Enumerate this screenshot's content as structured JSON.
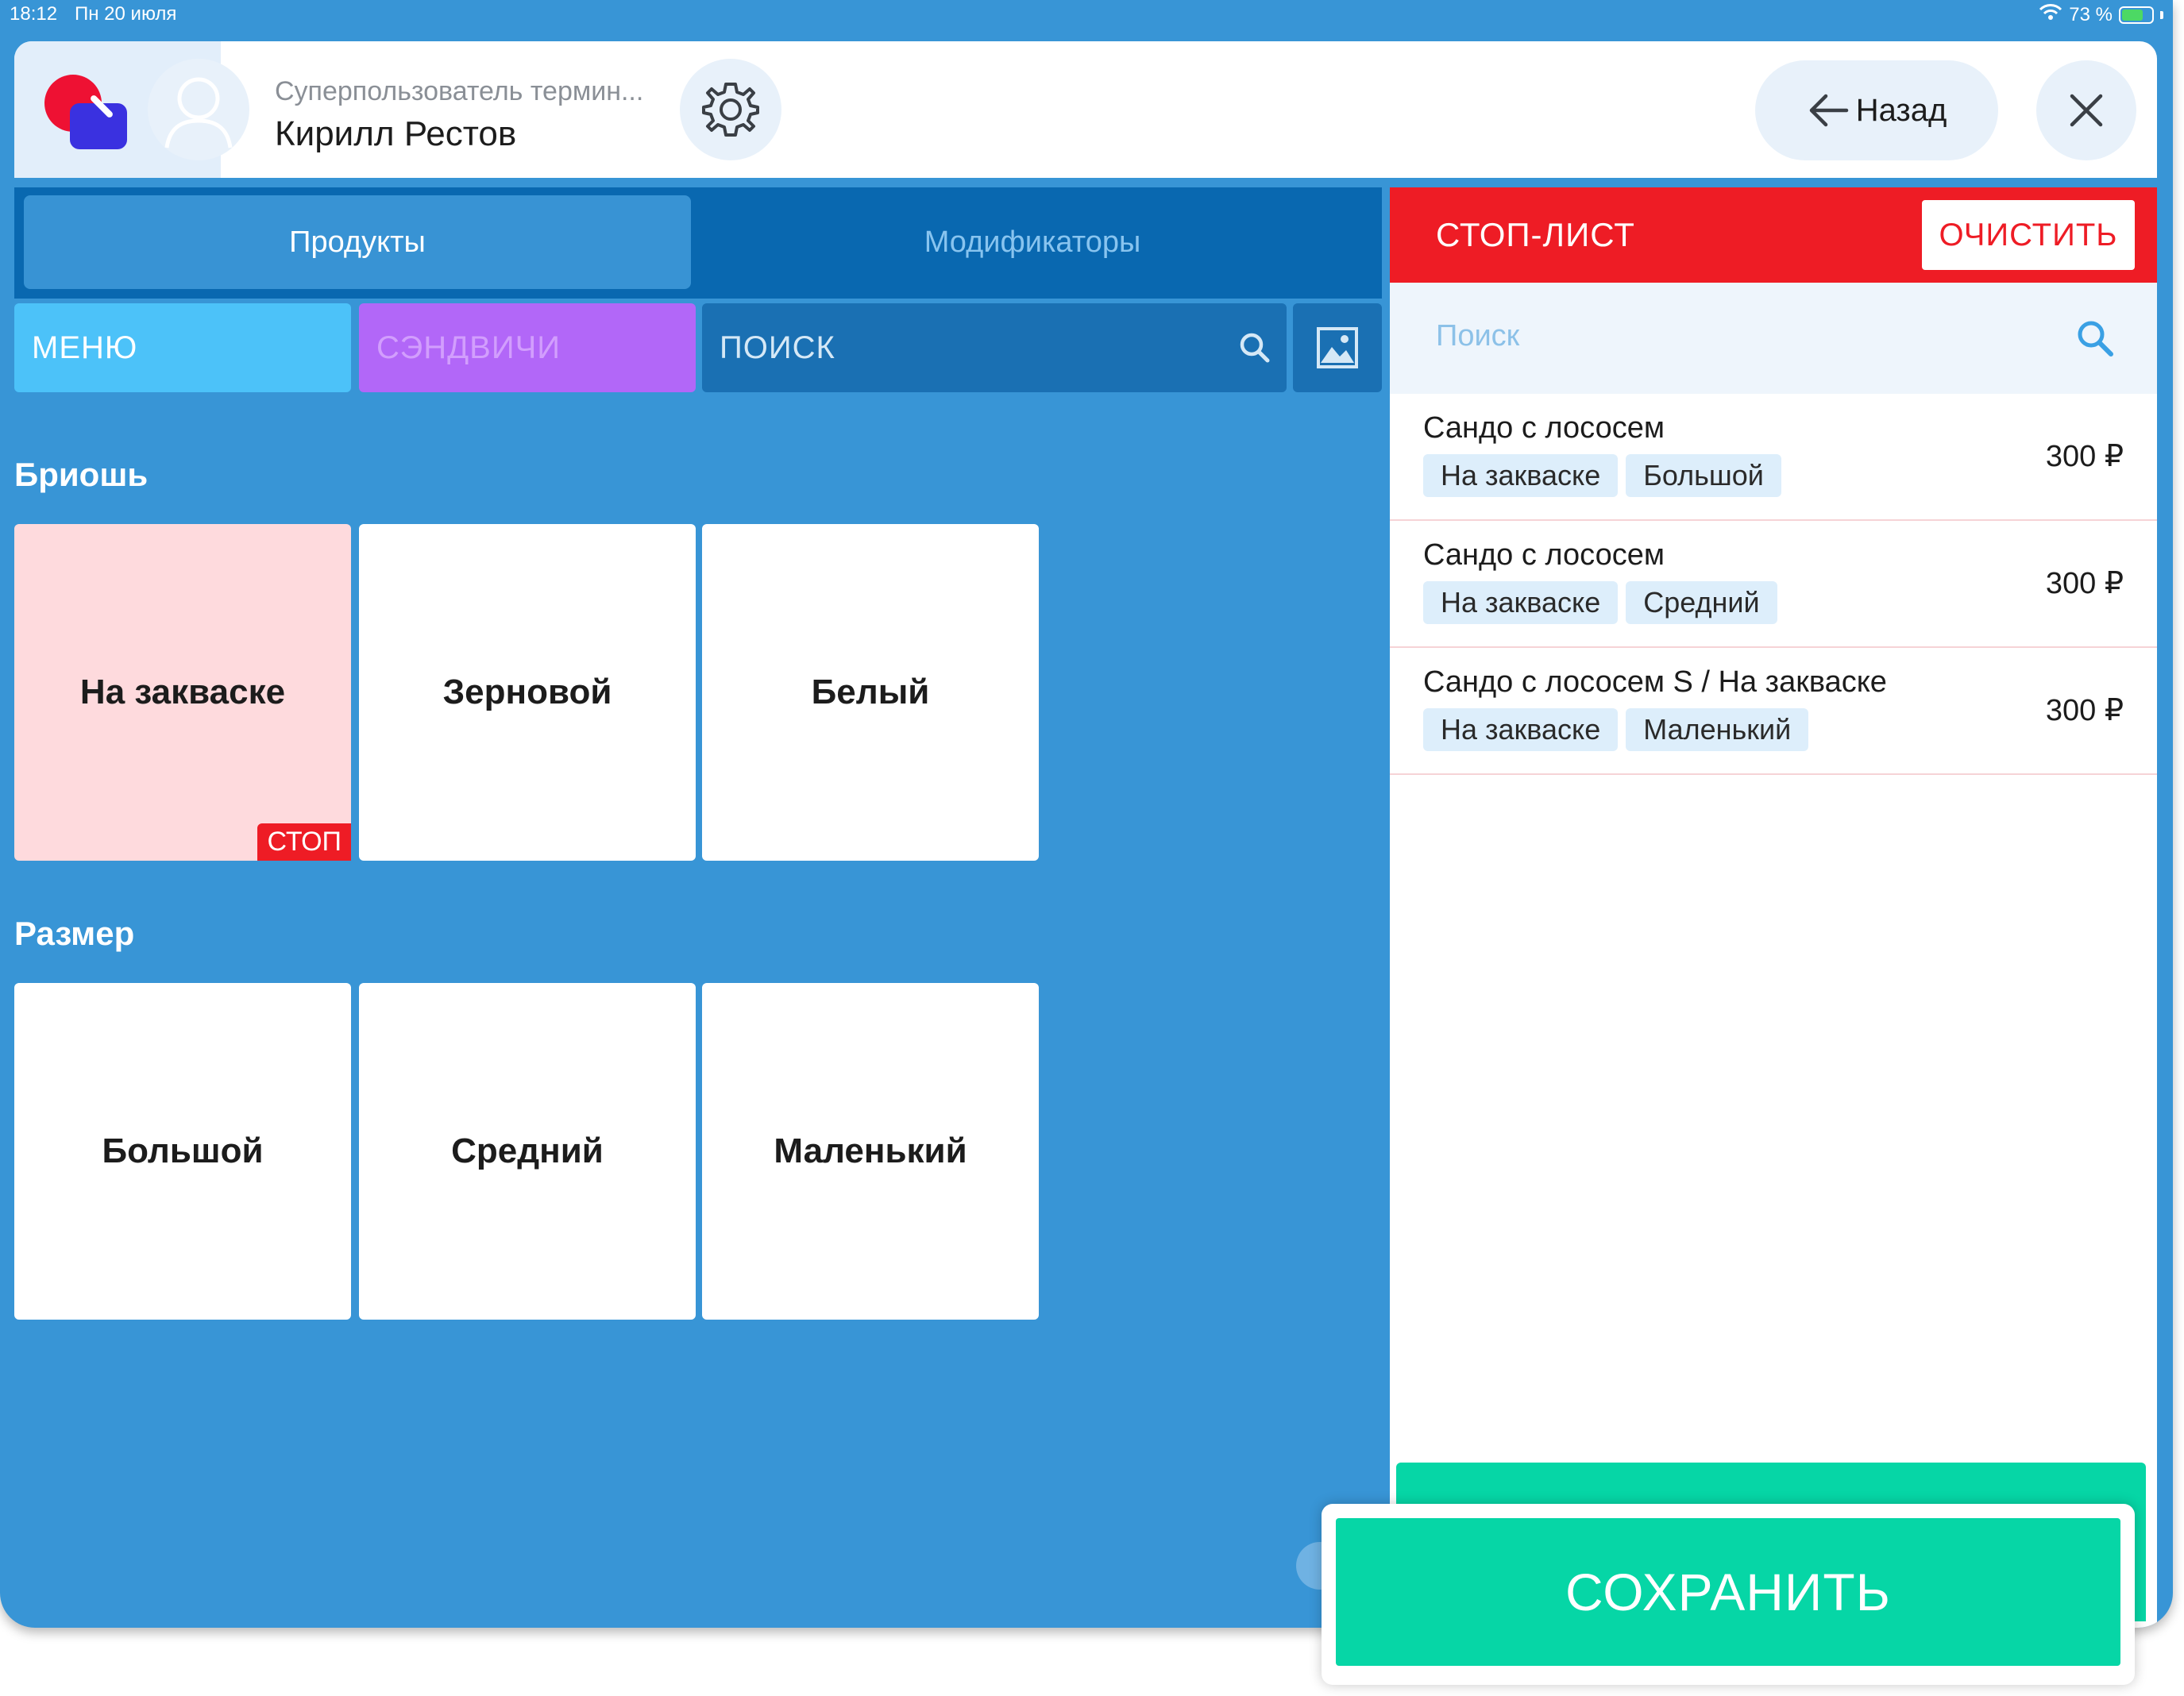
{
  "status_bar": {
    "time": "18:12",
    "date": "Пн 20 июля",
    "battery_text": "73 %",
    "battery_level": 0.73
  },
  "header": {
    "user_role": "Суперпользователь термин...",
    "user_name": "Кирилл Рестов",
    "back_label": "Назад"
  },
  "tabs": [
    {
      "label": "Продукты",
      "active": true
    },
    {
      "label": "Модификаторы",
      "active": false
    }
  ],
  "filters": {
    "menu": "МЕНЮ",
    "sandwiches": "СЭНДВИЧИ",
    "search_placeholder": "ПОИСК"
  },
  "sections": [
    {
      "title": "Бриошь",
      "tiles": [
        {
          "label": "На закваске",
          "stopped": true,
          "badge": "СТОП"
        },
        {
          "label": "Зерновой",
          "stopped": false
        },
        {
          "label": "Белый",
          "stopped": false
        }
      ]
    },
    {
      "title": "Размер",
      "tiles": [
        {
          "label": "Большой",
          "stopped": false
        },
        {
          "label": "Средний",
          "stopped": false
        },
        {
          "label": "Маленький",
          "stopped": false
        }
      ]
    }
  ],
  "stop_list": {
    "title": "СТОП-ЛИСТ",
    "clear_label": "ОЧИСТИТЬ",
    "search_placeholder": "Поиск",
    "items": [
      {
        "name": "Сандо с лососем",
        "tags": [
          "На закваске",
          "Большой"
        ],
        "price": "300 ₽"
      },
      {
        "name": "Сандо с лососем",
        "tags": [
          "На закваске",
          "Средний"
        ],
        "price": "300 ₽"
      },
      {
        "name": "Сандо с лососем S / На закваске",
        "tags": [
          "На закваске",
          "Маленький"
        ],
        "price": "300 ₽"
      }
    ]
  },
  "save_label": "СОХРАНИТЬ",
  "colors": {
    "background_blue": "#3895d6",
    "tab_bar": "#0968b0",
    "menu_chip": "#4cc2f9",
    "sandwich_chip": "#b267f8",
    "stop_red": "#ee1c25",
    "save_green": "#06d6a6",
    "stopped_tile": "#fedadd"
  },
  "icons": [
    "wifi-icon",
    "battery-icon",
    "logo-icon",
    "avatar-icon",
    "gear-icon",
    "arrow-left-icon",
    "close-icon",
    "search-icon",
    "image-icon"
  ]
}
